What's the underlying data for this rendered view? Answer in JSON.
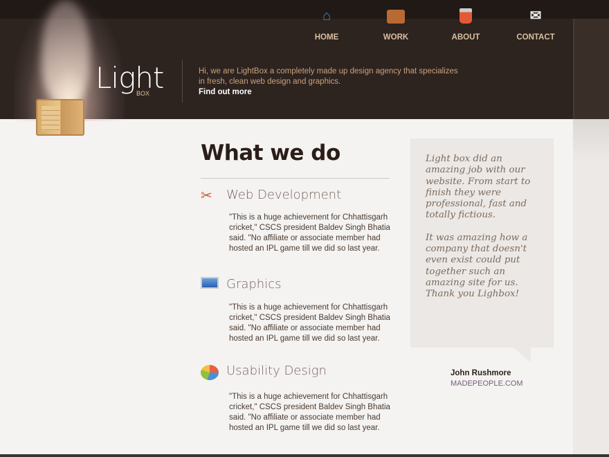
{
  "nav": [
    {
      "label": "HOME",
      "icon": "home-icon"
    },
    {
      "label": "WORK",
      "icon": "briefcase-icon"
    },
    {
      "label": "ABOUT",
      "icon": "paint-bucket-icon"
    },
    {
      "label": "CONTACT",
      "icon": "mail-add-icon"
    }
  ],
  "logo": {
    "main": "Light",
    "sub": "BOX"
  },
  "intro": {
    "text": "Hi, we are LightBox a completely made up design agency that specializes in fresh, clean web design and graphics.",
    "link": "Find out more"
  },
  "main": {
    "heading": "What we do",
    "services": [
      {
        "title": "Web Development",
        "icon": "tools-icon",
        "text": "\"This is a huge achievement for Chhattisgarh cricket,\" CSCS president Baldev Singh Bhatia said. \"No affiliate or associate member had hosted an IPL game till we did so last year."
      },
      {
        "title": "Graphics",
        "icon": "monitor-icon",
        "text": "\"This is a huge achievement for Chhattisgarh cricket,\" CSCS president Baldev Singh Bhatia said. \"No affiliate or associate member had hosted an IPL game till we did so last year."
      },
      {
        "title": "Usability Design",
        "icon": "pie-chart-icon",
        "text": "\"This is a huge achievement for Chhattisgarh cricket,\" CSCS president Baldev Singh Bhatia said. \"No affiliate or associate member had hosted an IPL game till we did so last year."
      }
    ]
  },
  "testimonial": {
    "paragraphs": [
      "Light box did an amazing job with our website. From start to finish they were professional, fast and totally fictious.",
      "It was amazing how a company that doesn't even exist could put together such an amazing site for us. Thank you Lighbox!"
    ],
    "author": "John Rushmore",
    "site": "MADEPEOPLE.COM"
  }
}
